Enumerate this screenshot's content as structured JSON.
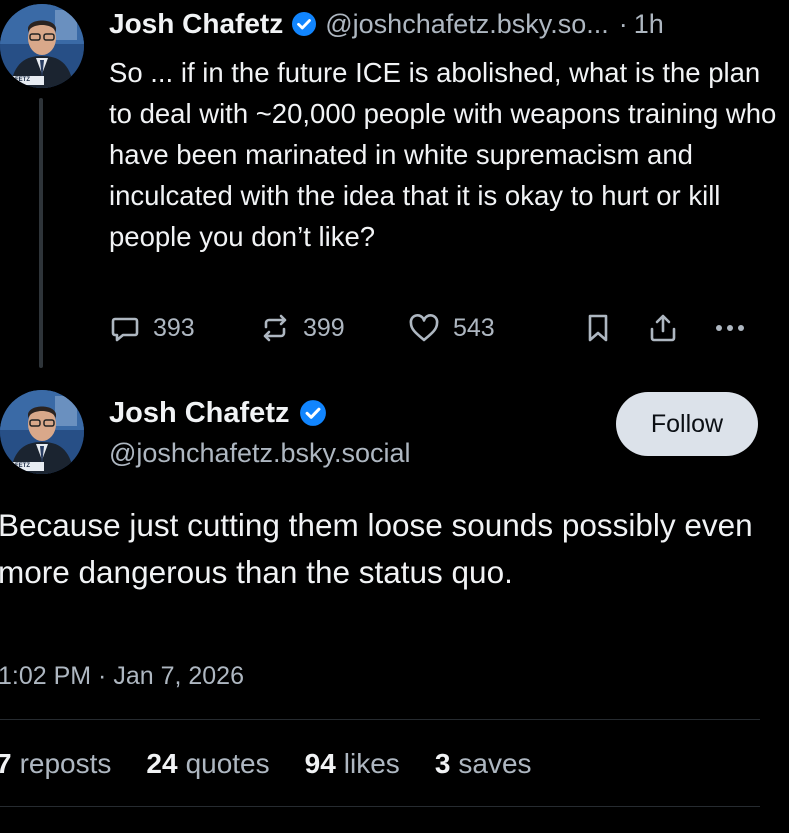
{
  "parent_post": {
    "author_name": "Josh Chafetz",
    "author_handle": "@joshchafetz.bsky.so...",
    "separator": "·",
    "age": "1h",
    "text": "So ... if in the future ICE is abolished, what is the plan to deal with ~20,000 people with weapons training who have been marinated in white supremacism and inculcated with the idea that it is okay to hurt or kill people you don’t like?",
    "replies": "393",
    "reposts": "399",
    "likes": "543",
    "avatar_caption": "CHAFETZ"
  },
  "main_post": {
    "author_name": "Josh Chafetz",
    "author_handle": "@joshchafetz.bsky.social",
    "follow_label": "Follow",
    "text": "Because just cutting them loose sounds possibly even more dangerous than the status quo.",
    "timestamp": "1:02 PM · Jan 7, 2026",
    "avatar_caption": "CHAFETZ",
    "stats": [
      {
        "num": "7",
        "label": "reposts"
      },
      {
        "num": "24",
        "label": "quotes"
      },
      {
        "num": "94",
        "label": "likes"
      },
      {
        "num": "3",
        "label": "saves"
      }
    ]
  },
  "colors": {
    "background": "#000000",
    "text": "#f1f3f5",
    "secondary": "#aeb7c1",
    "verified": "#1185fe",
    "follow_bg": "#dce2ea"
  },
  "icons": [
    "verified-badge-icon",
    "reply-icon",
    "repost-icon",
    "like-icon",
    "bookmark-icon",
    "share-icon",
    "more-icon"
  ]
}
